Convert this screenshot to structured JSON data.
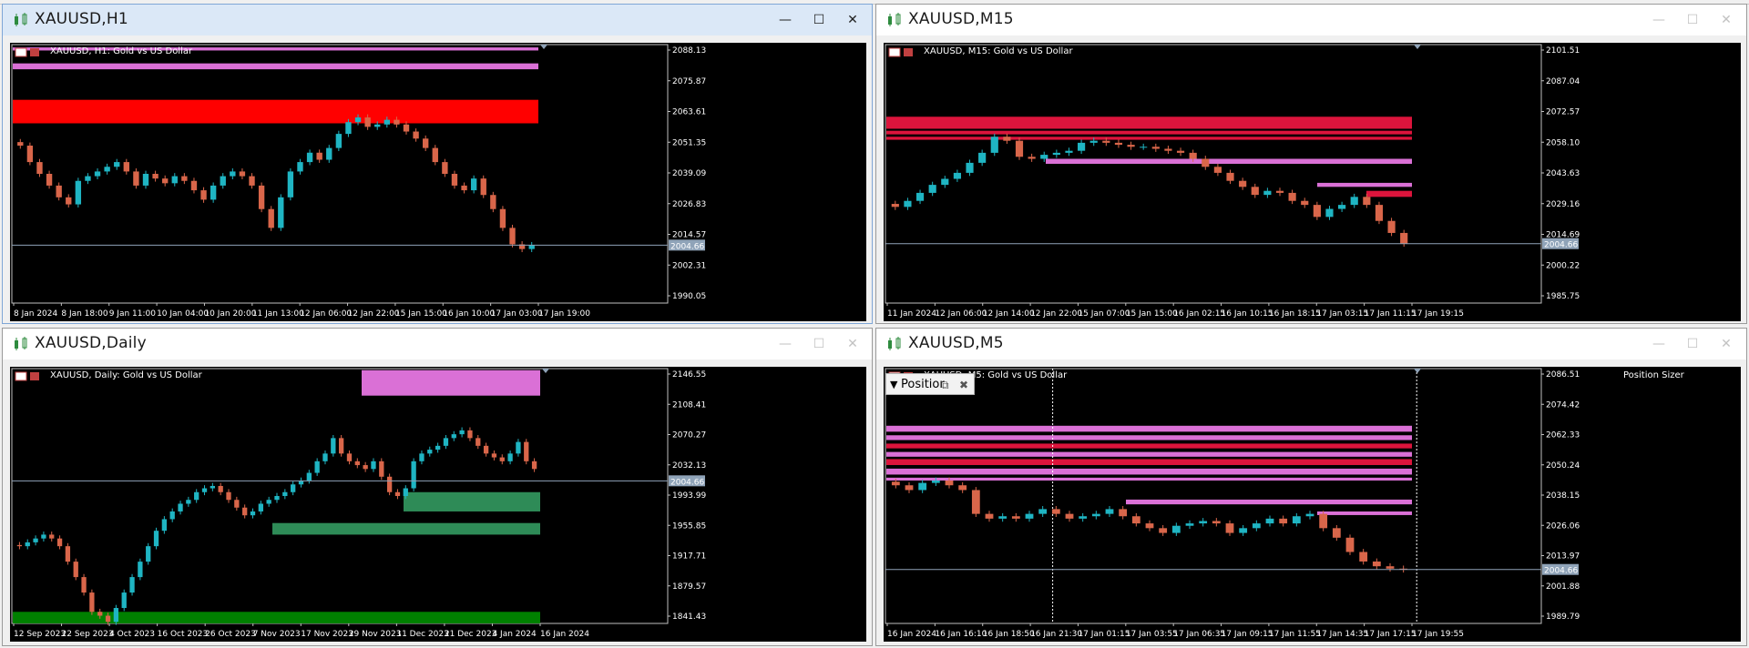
{
  "windows": [
    {
      "id": "h1",
      "title": "XAUUSD,H1",
      "active": true,
      "chart_label": "XAUUSD, H1:  Gold vs US Dollar",
      "price_tag": "2004.66",
      "controls": {
        "minimize": "—",
        "maximize": "☐",
        "close": "✕"
      }
    },
    {
      "id": "m15",
      "title": "XAUUSD,M15",
      "active": false,
      "chart_label": "XAUUSD, M15:  Gold vs US Dollar",
      "price_tag": "2004.66",
      "controls": {
        "minimize": "—",
        "maximize": "☐",
        "close": "✕"
      }
    },
    {
      "id": "daily",
      "title": "XAUUSD,Daily",
      "active": false,
      "chart_label": "XAUUSD, Daily:  Gold vs US Dollar",
      "price_tag": "2004.66",
      "controls": {
        "minimize": "—",
        "maximize": "☐",
        "close": "✕"
      }
    },
    {
      "id": "m5",
      "title": "XAUUSD,M5",
      "active": false,
      "chart_label": "XAUUSD, M5:  Gold vs US Dollar",
      "price_tag": "2004.66",
      "controls": {
        "minimize": "—",
        "maximize": "☐",
        "close": "✕"
      }
    }
  ],
  "position_sizer": {
    "panel_title": "Positior",
    "label": "Position Sizer",
    "collapse_icon": "triangle-down-icon",
    "restore_icon": "restore-icon",
    "close_icon": "close-icon"
  },
  "chart_data": [
    {
      "type": "candlestick",
      "symbol": "XAUUSD",
      "timeframe": "H1",
      "y_ticks": [
        "2088.13",
        "2075.87",
        "2063.61",
        "2051.35",
        "2039.09",
        "2026.83",
        "2014.57",
        "2002.31",
        "1990.05"
      ],
      "x_ticks": [
        "8 Jan 2024",
        "8 Jan 18:00",
        "9 Jan 11:00",
        "10 Jan 04:00",
        "10 Jan 20:00",
        "11 Jan 13:00",
        "12 Jan 06:00",
        "12 Jan 22:00",
        "15 Jan 15:00",
        "16 Jan 10:00",
        "17 Jan 03:00",
        "17 Jan 19:00"
      ],
      "current_price": 2004.66,
      "ylim": [
        1980,
        2090
      ],
      "close_path": [
        2047,
        2040,
        2035,
        2030,
        2025,
        2022,
        2032,
        2034,
        2036,
        2038,
        2040,
        2036,
        2030,
        2035,
        2033,
        2031,
        2034,
        2032,
        2028,
        2024,
        2030,
        2034,
        2036,
        2034,
        2030,
        2020,
        2012,
        2025,
        2036,
        2040,
        2044,
        2041,
        2046,
        2052,
        2057,
        2059,
        2055,
        2056,
        2058,
        2056,
        2053,
        2050,
        2046,
        2040,
        2035,
        2030,
        2028,
        2033,
        2026,
        2020,
        2012,
        2005,
        2003,
        2004.66
      ],
      "zones": [
        {
          "kind": "supply",
          "from": 2087.5,
          "to": 2088.8,
          "color": "#da70d6"
        },
        {
          "kind": "supply",
          "from": 2079.5,
          "to": 2082.0,
          "color": "#da70d6"
        },
        {
          "kind": "supply",
          "from": 2056.5,
          "to": 2066.5,
          "color": "#ff0000"
        }
      ]
    },
    {
      "type": "candlestick",
      "symbol": "XAUUSD",
      "timeframe": "M15",
      "y_ticks": [
        "2101.51",
        "2087.04",
        "2072.57",
        "2058.10",
        "2043.63",
        "2029.16",
        "2014.69",
        "2000.22",
        "1985.75"
      ],
      "x_ticks": [
        "11 Jan 2024",
        "12 Jan 06:00",
        "12 Jan 14:00",
        "12 Jan 22:00",
        "15 Jan 07:00",
        "15 Jan 15:00",
        "16 Jan 02:15",
        "16 Jan 10:15",
        "16 Jan 18:15",
        "17 Jan 03:15",
        "17 Jan 11:15",
        "17 Jan 19:15"
      ],
      "current_price": 2004.66,
      "ylim": [
        1975,
        2104
      ],
      "close_path": [
        2023,
        2026,
        2030,
        2034,
        2037,
        2040,
        2045,
        2050,
        2058,
        2056,
        2048,
        2047,
        2049,
        2050,
        2051,
        2055,
        2056,
        2055,
        2054,
        2053,
        2053,
        2052,
        2051,
        2050,
        2047,
        2043,
        2040,
        2036,
        2033,
        2029,
        2031,
        2030,
        2026,
        2024,
        2018,
        2022,
        2024,
        2028,
        2024,
        2016,
        2010,
        2004.66
      ],
      "zones": [
        {
          "kind": "supply",
          "from": 2062.0,
          "to": 2068.0,
          "color": "#dc143c"
        },
        {
          "kind": "supply",
          "from": 2059.2,
          "to": 2061.0,
          "color": "#dc143c"
        },
        {
          "kind": "supply",
          "from": 2056.5,
          "to": 2058.0,
          "color": "#dc143c"
        },
        {
          "kind": "supply",
          "from": 2044.5,
          "to": 2047.0,
          "color": "#da70d6"
        },
        {
          "kind": "supply",
          "from": 2033.0,
          "to": 2035.0,
          "color": "#da70d6"
        },
        {
          "kind": "supply",
          "from": 2028.0,
          "to": 2031.0,
          "color": "#dc143c"
        }
      ]
    },
    {
      "type": "candlestick",
      "symbol": "XAUUSD",
      "timeframe": "Daily",
      "y_ticks": [
        "2146.55",
        "2108.41",
        "2070.27",
        "2032.13",
        "1993.99",
        "1955.85",
        "1917.71",
        "1879.57",
        "1841.43"
      ],
      "x_ticks": [
        "12 Sep 2023",
        "22 Sep 2023",
        "4 Oct 2023",
        "16 Oct 2023",
        "26 Oct 2023",
        "7 Nov 2023",
        "17 Nov 2023",
        "29 Nov 2023",
        "11 Dec 2023",
        "21 Dec 2023",
        "4 Jan 2024",
        "16 Jan 2024"
      ],
      "current_price": 2004.66,
      "ylim": [
        1820,
        2150
      ],
      "close_path": [
        1920,
        1925,
        1930,
        1935,
        1930,
        1920,
        1900,
        1880,
        1860,
        1835,
        1830,
        1822,
        1840,
        1860,
        1880,
        1900,
        1920,
        1940,
        1955,
        1965,
        1975,
        1980,
        1990,
        1995,
        1998,
        1990,
        1980,
        1970,
        1960,
        1965,
        1975,
        1980,
        1985,
        1990,
        2000,
        2005,
        2015,
        2030,
        2040,
        2060,
        2040,
        2030,
        2025,
        2020,
        2030,
        2010,
        1990,
        1985,
        1995,
        2030,
        2040,
        2045,
        2050,
        2060,
        2065,
        2070,
        2060,
        2050,
        2040,
        2035,
        2030,
        2040,
        2055,
        2030,
        2020
      ],
      "zones": [
        {
          "kind": "supply",
          "from": 2115.0,
          "to": 2148.0,
          "color": "#da70d6"
        },
        {
          "kind": "demand",
          "from": 1965.0,
          "to": 1990.0,
          "color": "#2e8b57"
        },
        {
          "kind": "demand",
          "from": 1935.0,
          "to": 1950.0,
          "color": "#2e8b57"
        },
        {
          "kind": "demand",
          "from": 1820.0,
          "to": 1835.0,
          "color": "#008000"
        }
      ]
    },
    {
      "type": "candlestick",
      "symbol": "XAUUSD",
      "timeframe": "M5",
      "y_ticks": [
        "2086.51",
        "2074.42",
        "2062.33",
        "2050.24",
        "2038.15",
        "2026.06",
        "2013.97",
        "2001.88",
        "1989.79"
      ],
      "x_ticks": [
        "16 Jan 2024",
        "16 Jan 16:10",
        "16 Jan 18:50",
        "16 Jan 21:30",
        "17 Jan 01:15",
        "17 Jan 03:55",
        "17 Jan 06:35",
        "17 Jan 09:15",
        "17 Jan 11:55",
        "17 Jan 14:35",
        "17 Jan 17:15",
        "17 Jan 19:55"
      ],
      "current_price": 2004.66,
      "ylim": [
        1982,
        2089
      ],
      "close_path": [
        2040,
        2038,
        2041,
        2042,
        2040,
        2038,
        2028,
        2026,
        2027,
        2026,
        2028,
        2030,
        2028,
        2026,
        2027,
        2028,
        2030,
        2027,
        2024,
        2022,
        2020,
        2023,
        2024,
        2025,
        2024,
        2020,
        2022,
        2024,
        2026,
        2024,
        2027,
        2028,
        2022,
        2018,
        2012,
        2008,
        2006,
        2005,
        2004.66
      ],
      "zones": [
        {
          "kind": "supply",
          "from": 2062.5,
          "to": 2065.0,
          "color": "#da70d6"
        },
        {
          "kind": "supply",
          "from": 2059.0,
          "to": 2061.0,
          "color": "#da70d6"
        },
        {
          "kind": "supply",
          "from": 2055.5,
          "to": 2057.5,
          "color": "#dc143c"
        },
        {
          "kind": "supply",
          "from": 2052.0,
          "to": 2054.0,
          "color": "#da70d6"
        },
        {
          "kind": "supply",
          "from": 2048.5,
          "to": 2051.0,
          "color": "#dc143c"
        },
        {
          "kind": "supply",
          "from": 2044.5,
          "to": 2047.0,
          "color": "#da70d6"
        },
        {
          "kind": "supply",
          "from": 2042.0,
          "to": 2043.2,
          "color": "#da70d6"
        },
        {
          "kind": "supply",
          "from": 2032.0,
          "to": 2034.0,
          "color": "#da70d6"
        },
        {
          "kind": "supply",
          "from": 2027.5,
          "to": 2029.0,
          "color": "#da70d6"
        }
      ],
      "vlines": [
        0.255,
        0.81
      ]
    }
  ]
}
